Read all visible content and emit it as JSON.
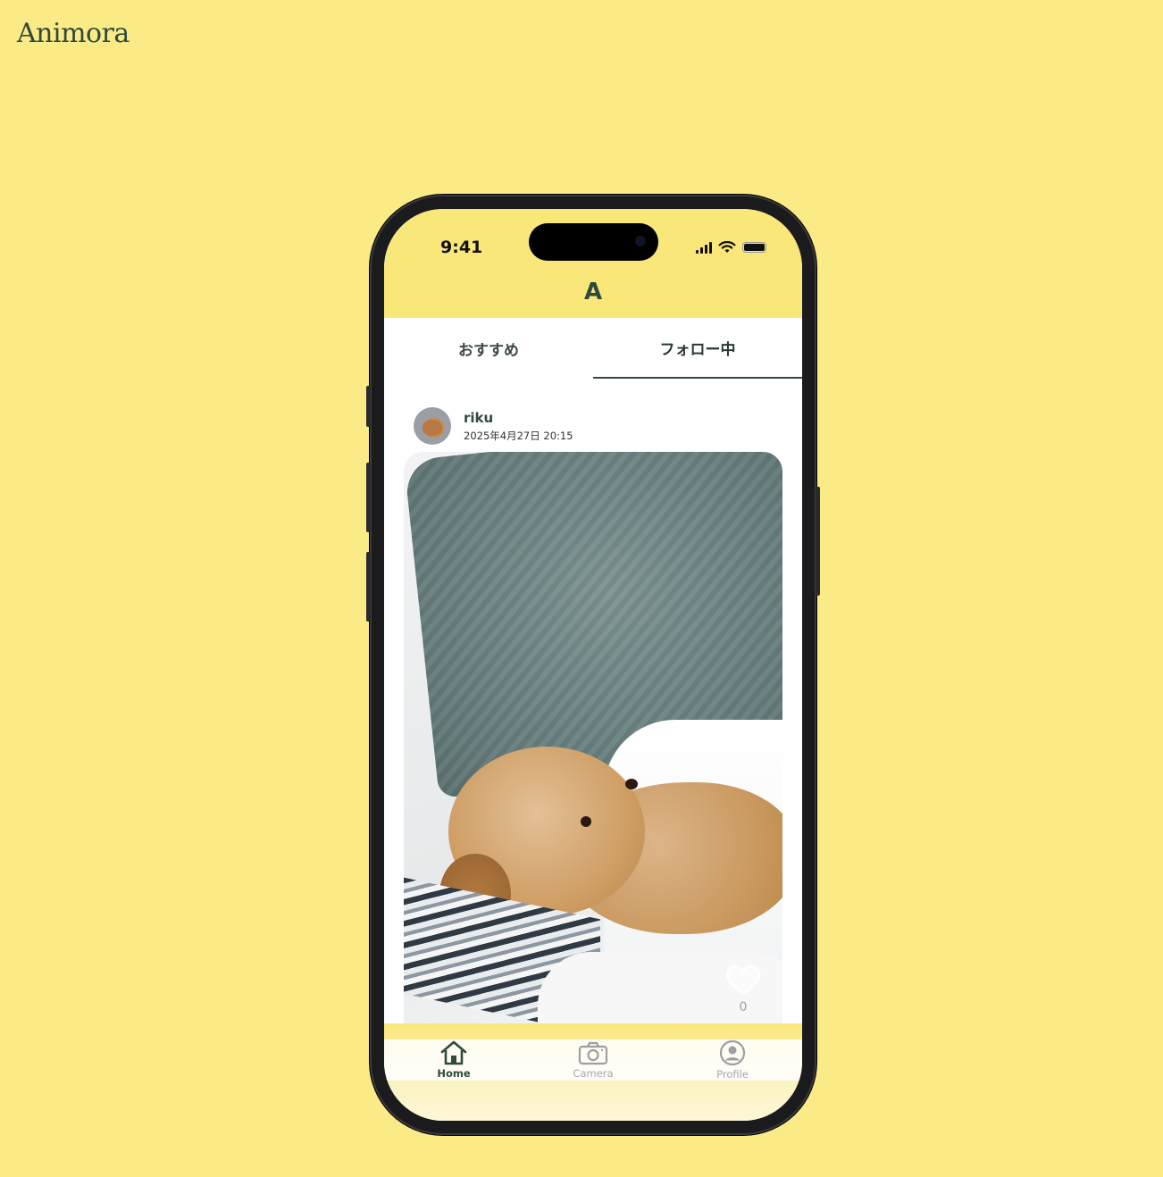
{
  "page": {
    "brand": "Animora"
  },
  "status_bar": {
    "time": "9:41"
  },
  "app_header": {
    "logo_letter": "A"
  },
  "tabs": [
    {
      "label": "おすすめ",
      "active": false
    },
    {
      "label": "フォロー中",
      "active": true
    }
  ],
  "post": {
    "username": "riku",
    "timestamp": "2025年4月27日 20:15",
    "likes": "0"
  },
  "tab_bar": [
    {
      "label": "Home",
      "icon": "home-icon",
      "active": true
    },
    {
      "label": "Camera",
      "icon": "camera-icon",
      "active": false
    },
    {
      "label": "Profile",
      "icon": "profile-icon",
      "active": false
    }
  ],
  "colors": {
    "background": "#FBEB87",
    "header_yellow": "#F9E77A",
    "brand_green": "#2F4A3C"
  }
}
